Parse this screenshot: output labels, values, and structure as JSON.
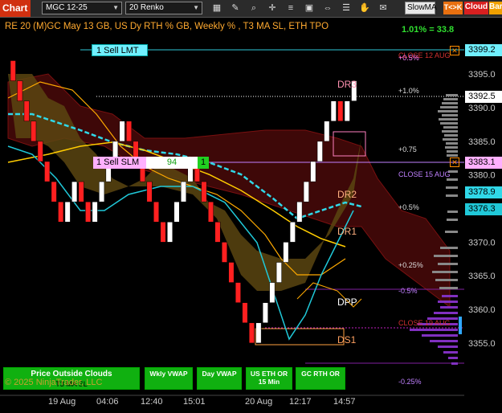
{
  "toolbar": {
    "chart_tab": "Chart",
    "instrument": "MGC 12-25",
    "bar_type": "20 Renko",
    "slowma": "SlowMA",
    "tk": "T<>K",
    "cloud": "Cloud",
    "bar": "Bar"
  },
  "title": "RE 20  (M)GC May 13 GB, US Dy RTH % GB, Weekly % , T3 MA SL, ETH TPO",
  "pct_change": "1.01% = 33.8",
  "orders": {
    "sell_lmt": "1 Sell LMT",
    "sell_slm": "1 Sell SLM",
    "slm_qty": "94",
    "slm_right": "1"
  },
  "price_badges": {
    "current": "3392.5",
    "lmt": "3399.2",
    "slm": "3383.1",
    "cyan1": "3378.9",
    "cyan2": "3376.3"
  },
  "labels": {
    "dr3": "DR3",
    "dr2": "DR2",
    "dr1": "DR1",
    "dpp": "DPP",
    "ds1": "DS1",
    "close12": "CLOSE 12 AUG",
    "close15": "CLOSE 15 AUG",
    "close19": "CLOSE 19 AUG",
    "p05a": "+0.5%",
    "p10": "+1.0%",
    "p075": "+0.75",
    "p05b": "+0.5%",
    "p025": "+0.25%",
    "m05": "-0.5%",
    "m025": "-0.25%"
  },
  "yaxis": [
    "3395.0",
    "3390.0",
    "3385.0",
    "3380.0",
    "3375.0",
    "3370.0",
    "3365.0",
    "3360.0",
    "3355.0"
  ],
  "xaxis": [
    "19 Aug",
    "04:06",
    "12:40",
    "15:01",
    "20 Aug",
    "12:17",
    "14:57"
  ],
  "bottom_buttons": {
    "outside_clouds": "Price Outside Clouds",
    "t3": "T3 MA SL",
    "wkly": "Wkly VWAP",
    "day": "Day VWAP",
    "us_eth": "US ETH OR 15 Min",
    "gc_rth": "GC RTH OR"
  },
  "copyright": "© 2025 NinjaTrader, LLC",
  "colors": {
    "up": "#ffffff",
    "down": "#ff2020",
    "cloud_down": "#5a0a0a",
    "cloud_up": "#806010",
    "cyan": "#20d8e8",
    "accent": "#d03010"
  },
  "chart_data": {
    "type": "renko",
    "y_unit": "price",
    "ylim": [
      3352,
      3401
    ],
    "bricks": [
      [
        3397,
        3394
      ],
      [
        3394,
        3391
      ],
      [
        3391,
        3388
      ],
      [
        3388,
        3385
      ],
      [
        3385,
        3382
      ],
      [
        3382,
        3379
      ],
      [
        3379,
        3376
      ],
      [
        3376,
        3373
      ],
      [
        3373,
        3376
      ],
      [
        3376,
        3379
      ],
      [
        3379,
        3376
      ],
      [
        3376,
        3373
      ],
      [
        3373,
        3376
      ],
      [
        3376,
        3379
      ],
      [
        3379,
        3382
      ],
      [
        3382,
        3385
      ],
      [
        3385,
        3388
      ],
      [
        3388,
        3385
      ],
      [
        3385,
        3382
      ],
      [
        3382,
        3379
      ],
      [
        3379,
        3376
      ],
      [
        3376,
        3373
      ],
      [
        3373,
        3370
      ],
      [
        3370,
        3373
      ],
      [
        3373,
        3376
      ],
      [
        3376,
        3379
      ],
      [
        3379,
        3382
      ],
      [
        3382,
        3379
      ],
      [
        3379,
        3376
      ],
      [
        3376,
        3373
      ],
      [
        3373,
        3370
      ],
      [
        3370,
        3367
      ],
      [
        3367,
        3364
      ],
      [
        3364,
        3361
      ],
      [
        3361,
        3358
      ],
      [
        3358,
        3355
      ],
      [
        3355,
        3358
      ],
      [
        3358,
        3361
      ],
      [
        3361,
        3364
      ],
      [
        3364,
        3367
      ],
      [
        3367,
        3370
      ],
      [
        3370,
        3373
      ],
      [
        3373,
        3376
      ],
      [
        3376,
        3379
      ],
      [
        3379,
        3382
      ],
      [
        3382,
        3385
      ],
      [
        3385,
        3388
      ],
      [
        3388,
        3391
      ],
      [
        3391,
        3388
      ],
      [
        3388,
        3391
      ],
      [
        3391,
        3394
      ]
    ]
  }
}
